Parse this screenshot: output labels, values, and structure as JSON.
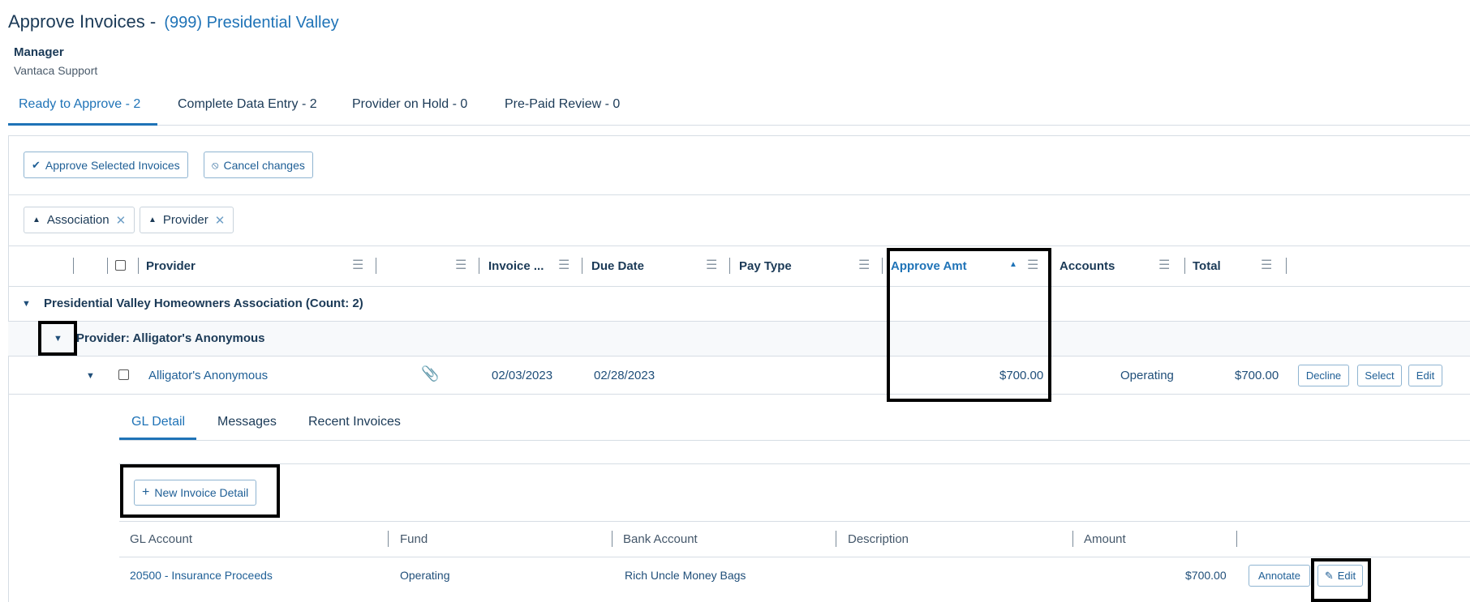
{
  "page": {
    "title": "Approve Invoices -",
    "association": "(999) Presidential Valley",
    "manager_label": "Manager",
    "manager_name": "Vantaca Support"
  },
  "tabs": [
    {
      "label": "Ready to Approve - 2",
      "active": true
    },
    {
      "label": "Complete Data Entry - 2",
      "active": false
    },
    {
      "label": "Provider on Hold - 0",
      "active": false
    },
    {
      "label": "Pre-Paid Review - 0",
      "active": false
    }
  ],
  "toolbar": {
    "approve_label": "Approve Selected Invoices",
    "cancel_label": "Cancel changes"
  },
  "grouping_chips": [
    {
      "label": "Association"
    },
    {
      "label": "Provider"
    }
  ],
  "grid": {
    "columns": {
      "provider": "Provider",
      "invoice": "Invoice ...",
      "due_date": "Due Date",
      "pay_type": "Pay Type",
      "approve_amt": "Approve Amt",
      "accounts": "Accounts",
      "total": "Total"
    },
    "group_association": "Presidential Valley Homeowners Association (Count: 2)",
    "group_provider": "Provider: Alligator's Anonymous",
    "row": {
      "provider": "Alligator's Anonymous",
      "invoice_date": "02/03/2023",
      "due_date": "02/28/2023",
      "approve_amt": "$700.00",
      "accounts": "Operating",
      "total": "$700.00",
      "decline_label": "Decline",
      "select_label": "Select",
      "edit_label": "Edit"
    }
  },
  "detail_tabs": [
    {
      "label": "GL Detail",
      "active": true
    },
    {
      "label": "Messages",
      "active": false
    },
    {
      "label": "Recent Invoices",
      "active": false
    }
  ],
  "gl_detail": {
    "new_button_label": "New Invoice Detail",
    "columns": {
      "gl_account": "GL Account",
      "fund": "Fund",
      "bank_account": "Bank Account",
      "description": "Description",
      "amount": "Amount"
    },
    "row": {
      "gl_account": "20500 - Insurance Proceeds",
      "fund": "Operating",
      "bank_account": "Rich Uncle Money Bags",
      "description": "",
      "amount": "$700.00",
      "annotate_label": "Annotate",
      "edit_label": "Edit"
    }
  },
  "icons": {
    "check": "check-icon",
    "cancel": "cancel-circle-icon",
    "sort_up": "sort-up-icon",
    "close": "close-icon",
    "menu": "column-menu-icon",
    "caret_down": "caret-down-icon",
    "attachment": "paperclip-icon",
    "plus": "plus-icon",
    "pencil": "pencil-icon"
  },
  "colors": {
    "accent": "#1f73b7",
    "text_dark": "#1b3a57",
    "border": "#d6dde4",
    "button_border": "#8fb4d1",
    "highlight_box": "#000000"
  }
}
